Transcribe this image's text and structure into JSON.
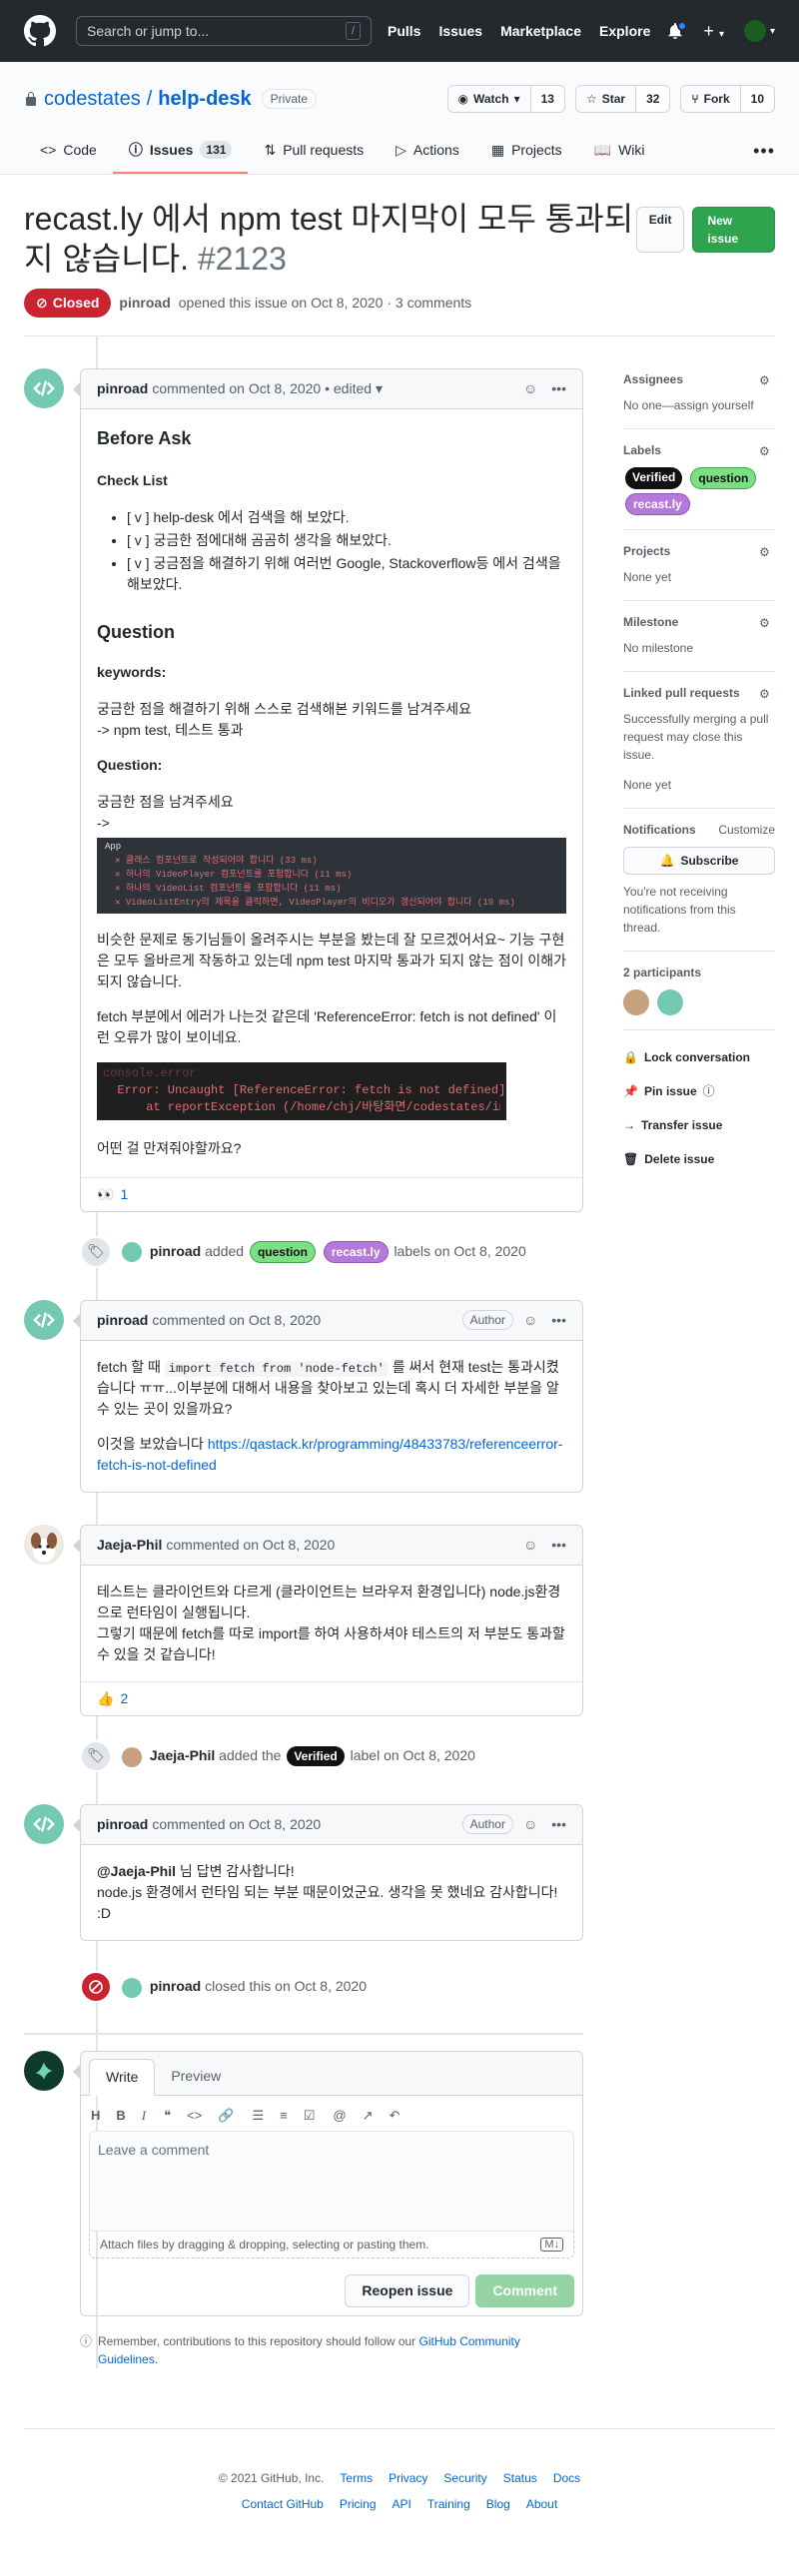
{
  "header": {
    "search_placeholder": "Search or jump to...",
    "search_key": "/",
    "nav": [
      "Pulls",
      "Issues",
      "Marketplace",
      "Explore"
    ],
    "plus": "+",
    "caret": "▾"
  },
  "repo": {
    "owner": "codestates",
    "sep": "/",
    "name": "help-desk",
    "visibility": "Private",
    "watch_label": "Watch",
    "watch_count": "13",
    "star_label": "Star",
    "star_count": "32",
    "fork_label": "Fork",
    "fork_count": "10"
  },
  "tabs": [
    {
      "label": "Code"
    },
    {
      "label": "Issues",
      "count": "131"
    },
    {
      "label": "Pull requests"
    },
    {
      "label": "Actions"
    },
    {
      "label": "Projects"
    },
    {
      "label": "Wiki"
    }
  ],
  "issue": {
    "title": "recast.ly 에서 npm test 마지막이 모두 통과되지 않습니다.",
    "number": "#2123",
    "edit_label": "Edit",
    "new_issue_label": "New issue",
    "state": "Closed",
    "author": "pinroad",
    "opened_text": "opened this issue on Oct 8, 2020 · 3 comments"
  },
  "comment1": {
    "author": "pinroad",
    "meta": "commented on Oct 8, 2020 • edited",
    "h_before": "Before Ask",
    "h_checklist": "Check List",
    "checklist": [
      "[ v ] help-desk 에서 검색을 해 보았다.",
      "[ v ] 궁금한 점에대해 곰곰히 생각을 해보았다.",
      "[ v ] 궁금점을 해결하기 위해 여러번 Google, Stackoverflow등 에서 검색을 해보았다."
    ],
    "h_question": "Question",
    "h_keywords": "keywords:",
    "kw_line1": "궁금한 점을 해결하기 위해 스스로 검색해본 키워드를 남겨주세요",
    "kw_line2": "-> npm test, 테스트 통과",
    "h_question2": "Question:",
    "q_line1": "궁금한 점을 남겨주세요",
    "q_line2": "->",
    "code_lines": [
      "App",
      "✕ 클래스 컴포넌트로 작성되어야 합니다 (33 ms)",
      "✕ 하나의 VideoPlayer 컴포넌트를 포함합니다 (11 ms)",
      "✕ 하나의 VideoList 컴포넌트를 포함합니다 (11 ms)",
      "✕ VideoListEntry의 제목을 클릭하면, VideoPlayer의 비디오가 갱신되어야 합니다 (19 ms)"
    ],
    "para1": "비슷한 문제로 동기님들이 올려주시는 부분을 봤는데 잘 모르겠어서요~ 기능 구현은 모두 올바르게 작동하고 있는데 npm test 마지막 통과가 되지 않는 점이 이해가 되지 않습니다.",
    "para2": "fetch 부분에서 에러가 나는것 같은데 'ReferenceError: fetch is not defined' 이런 오류가 많이 보이네요.",
    "err_lines": [
      "console.error",
      "  Error: Uncaught [ReferenceError: fetch is not defined]",
      "      at reportException (/home/chj/바탕화면/codestates/im"
    ],
    "para3": "어떤 걸 만져줘야할까요?",
    "reaction_emoji": "👀",
    "reaction_count": "1"
  },
  "event1": {
    "actor": "pinroad",
    "verb": "added",
    "labels": [
      "question",
      "recast.ly"
    ],
    "tail": "labels on Oct 8, 2020"
  },
  "comment2": {
    "author": "pinroad",
    "meta": "commented on Oct 8, 2020",
    "badge": "Author",
    "p1_a": "fetch 할 때 ",
    "p1_code": "import fetch from 'node-fetch'",
    "p1_b": " 를 써서 현재 test는 통과시켰습니다 ㅠㅠ...이부분에 대해서 내용을 찾아보고 있는데 혹시 더 자세한 부분을 알 수 있는 곳이 있을까요?",
    "p2_a": "이것을 보았습니다 ",
    "p2_link": "https://qastack.kr/programming/48433783/referenceerror-fetch-is-not-defined"
  },
  "comment3": {
    "author": "Jaeja-Phil",
    "meta": "commented on Oct 8, 2020",
    "body": [
      "테스트는 클라이언트와 다르게 (클라이언트는 브라우저 환경입니다) node.js환경으로 런타임이 실행됩니다.",
      "그렇기 때문에 fetch를 따로 import를 하여 사용하셔야 테스트의 저 부분도 통과할 수 있을 것 같습니다!"
    ],
    "reaction_emoji": "👍",
    "reaction_count": "2"
  },
  "event2": {
    "actor": "Jaeja-Phil",
    "verb": "added the",
    "label": "Verified",
    "tail": "label on Oct 8, 2020"
  },
  "comment4": {
    "author": "pinroad",
    "meta": "commented on Oct 8, 2020",
    "badge": "Author",
    "mention": "@Jaeja-Phil",
    "line1_rest": " 님 답변 감사합니다!",
    "line2": "node.js 환경에서 런타임 되는 부분 때문이었군요. 생각을 못 했네요 감사합니다! :D"
  },
  "event3": {
    "actor": "pinroad",
    "tail": "closed this on Oct 8, 2020"
  },
  "composer": {
    "tab_write": "Write",
    "tab_preview": "Preview",
    "placeholder": "Leave a comment",
    "attach": "Attach files by dragging & dropping, selecting or pasting them.",
    "reopen": "Reopen issue",
    "comment": "Comment",
    "remember_a": "Remember, contributions to this repository should follow our ",
    "remember_link": "GitHub Community Guidelines",
    "remember_b": "."
  },
  "sidebar": {
    "assignees_h": "Assignees",
    "assignees_v": "No one—assign yourself",
    "labels_h": "Labels",
    "labels": [
      "Verified",
      "question",
      "recast.ly"
    ],
    "projects_h": "Projects",
    "projects_v": "None yet",
    "milestone_h": "Milestone",
    "milestone_v": "No milestone",
    "linked_h": "Linked pull requests",
    "linked_desc": "Successfully merging a pull request may close this issue.",
    "linked_v": "None yet",
    "notif_h": "Notifications",
    "notif_customize": "Customize",
    "subscribe": "Subscribe",
    "notif_desc": "You're not receiving notifications from this thread.",
    "participants_h": "2 participants",
    "lock": "Lock conversation",
    "pin": "Pin issue",
    "transfer": "Transfer issue",
    "delete": "Delete issue"
  },
  "footer": {
    "copyright": "© 2021 GitHub, Inc.",
    "row1": [
      "Terms",
      "Privacy",
      "Security",
      "Status",
      "Docs"
    ],
    "row2": [
      "Contact GitHub",
      "Pricing",
      "API",
      "Training",
      "Blog",
      "About"
    ]
  },
  "colors": {
    "header_bg": "#24292e",
    "closed_red": "#cb2431",
    "green": "#2ea44f",
    "link": "#0366d6"
  }
}
